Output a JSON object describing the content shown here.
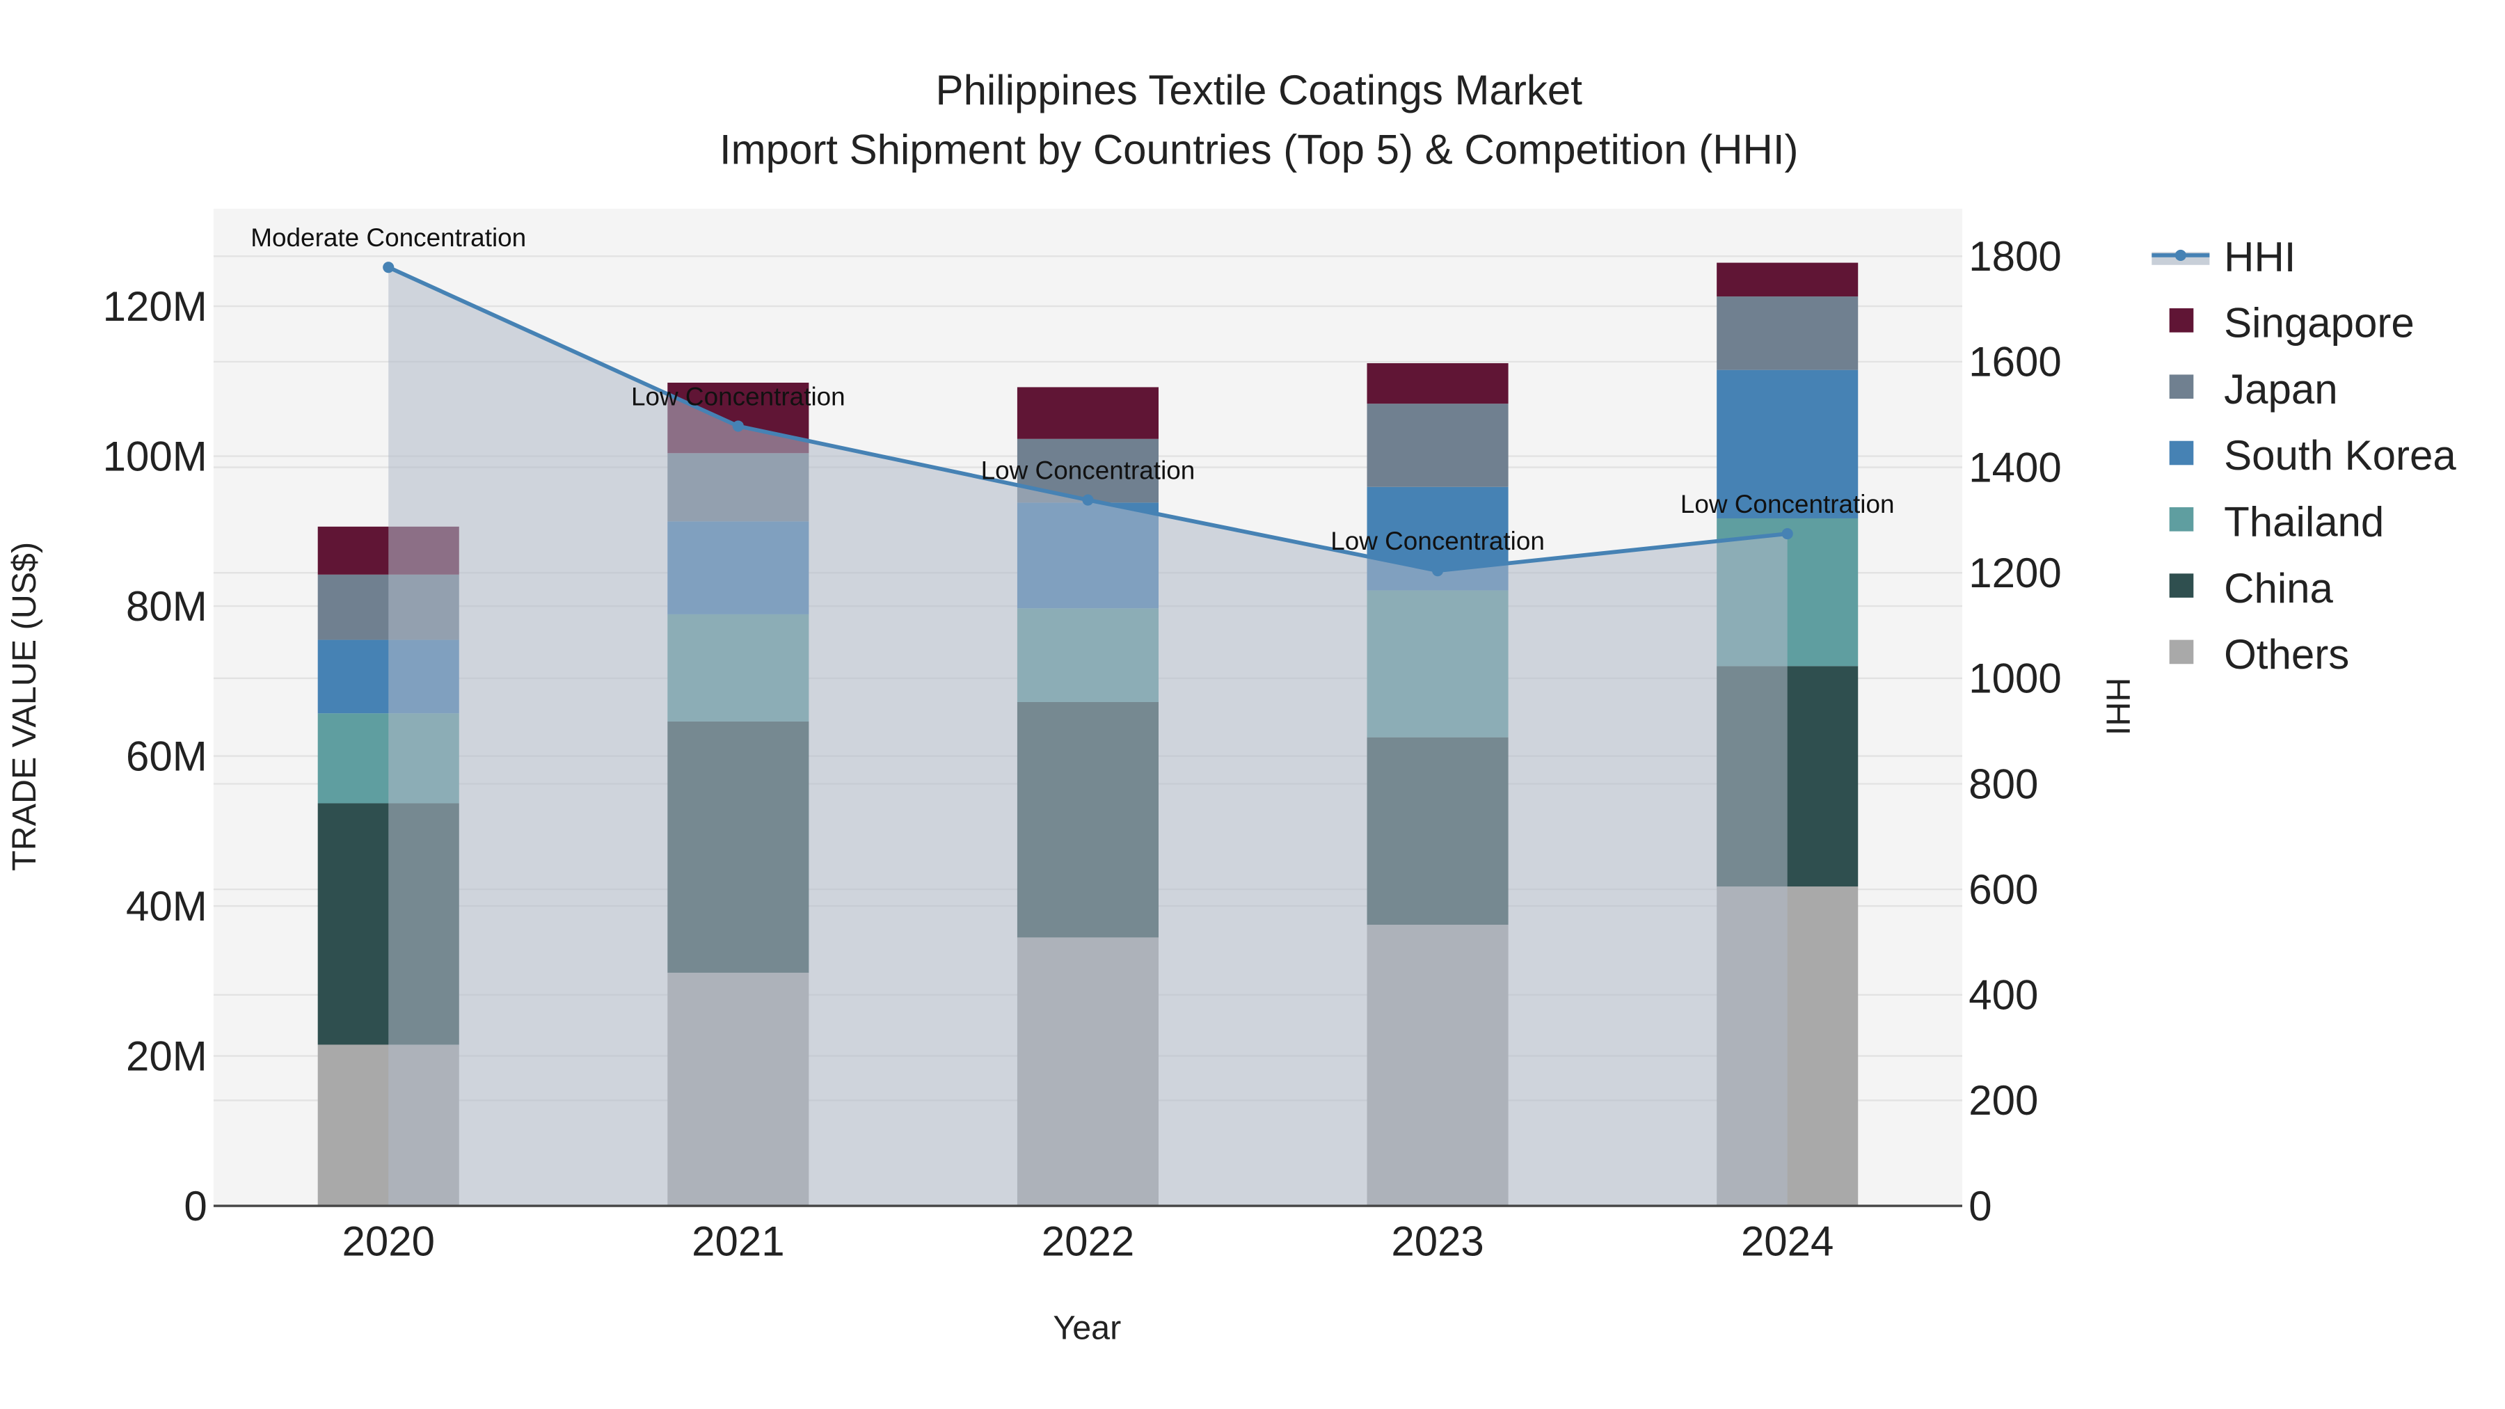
{
  "chart_data": {
    "type": "bar",
    "title": "Philippines Textile Coatings Market",
    "subtitle": "Import Shipment by Countries (Top 5) & Competition (HHI)",
    "xlabel": "Year",
    "ylabel": "TRADE VALUE (US$)",
    "y2label": "HHI",
    "categories": [
      "2020",
      "2021",
      "2022",
      "2023",
      "2024"
    ],
    "ylim": [
      0,
      133000000
    ],
    "y_ticks": [
      0,
      20000000,
      40000000,
      60000000,
      80000000,
      100000000,
      120000000
    ],
    "y_tick_labels": [
      "0",
      "20M",
      "40M",
      "60M",
      "80M",
      "100M",
      "120M"
    ],
    "y2lim": [
      0,
      1890
    ],
    "y2_ticks": [
      0,
      200,
      400,
      600,
      800,
      1000,
      1200,
      1400,
      1600,
      1800
    ],
    "y2_tick_labels": [
      "0",
      "200",
      "400",
      "600",
      "800",
      "1000",
      "1200",
      "1400",
      "1600",
      "1800"
    ],
    "stacked": true,
    "series": [
      {
        "name": "Others",
        "color": "#a9a9a9",
        "values": [
          21500000,
          31100000,
          35800000,
          37500000,
          42600000
        ]
      },
      {
        "name": "China",
        "color": "#2f4f4f",
        "values": [
          32200000,
          33500000,
          31400000,
          25000000,
          29400000
        ]
      },
      {
        "name": "Thailand",
        "color": "#5f9ea0",
        "values": [
          12000000,
          14300000,
          12500000,
          19600000,
          19700000
        ]
      },
      {
        "name": "South Korea",
        "color": "#4682b4",
        "values": [
          9800000,
          12400000,
          14100000,
          13800000,
          19800000
        ]
      },
      {
        "name": "Japan",
        "color": "#708090",
        "values": [
          8700000,
          9100000,
          8500000,
          11100000,
          9800000
        ]
      },
      {
        "name": "Singapore",
        "color": "#601535",
        "values": [
          6400000,
          9400000,
          6900000,
          5400000,
          4500000
        ]
      }
    ],
    "hhi": {
      "name": "HHI",
      "color": "#4682b4",
      "values": [
        1779,
        1478,
        1338,
        1204,
        1274
      ],
      "annotations": [
        "Moderate Concentration",
        "Low Concentration",
        "Low Concentration",
        "Low Concentration",
        "Low Concentration"
      ]
    },
    "legend_order": [
      "HHI",
      "Singapore",
      "Japan",
      "South Korea",
      "Thailand",
      "China",
      "Others"
    ],
    "legend_position": "right",
    "grid": true
  }
}
